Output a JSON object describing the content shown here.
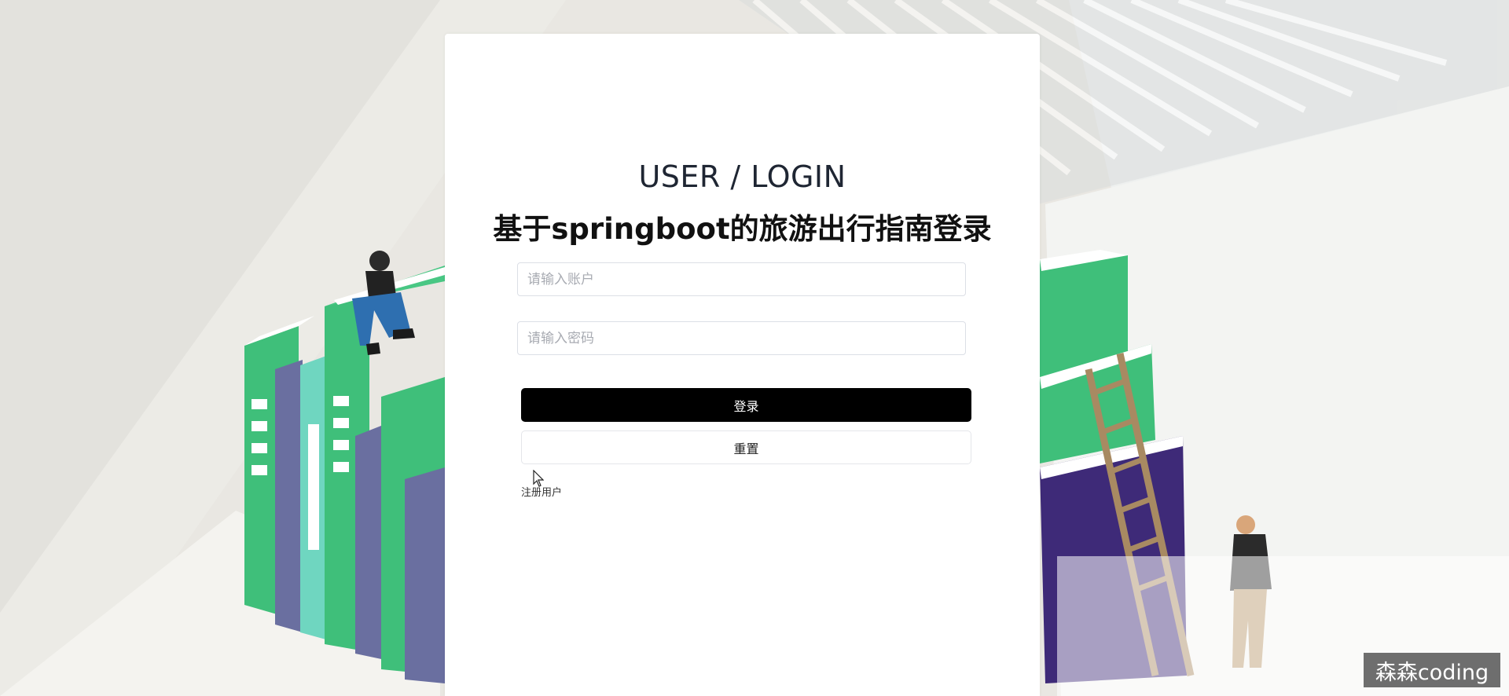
{
  "login": {
    "title_en": "USER / LOGIN",
    "title_cn": "基于springboot的旅游出行指南登录",
    "account_placeholder": "请输入账户",
    "password_placeholder": "请输入密码",
    "login_button": "登录",
    "reset_button": "重置",
    "register_link": "注册用户"
  },
  "watermark": {
    "text": "森森coding"
  },
  "colors": {
    "login_button_bg": "#000000",
    "book_green": "#3fbf7a",
    "book_purple": "#6a6fa0",
    "book_dark_purple": "#3e2a78",
    "book_teal": "#6fd6c0"
  }
}
